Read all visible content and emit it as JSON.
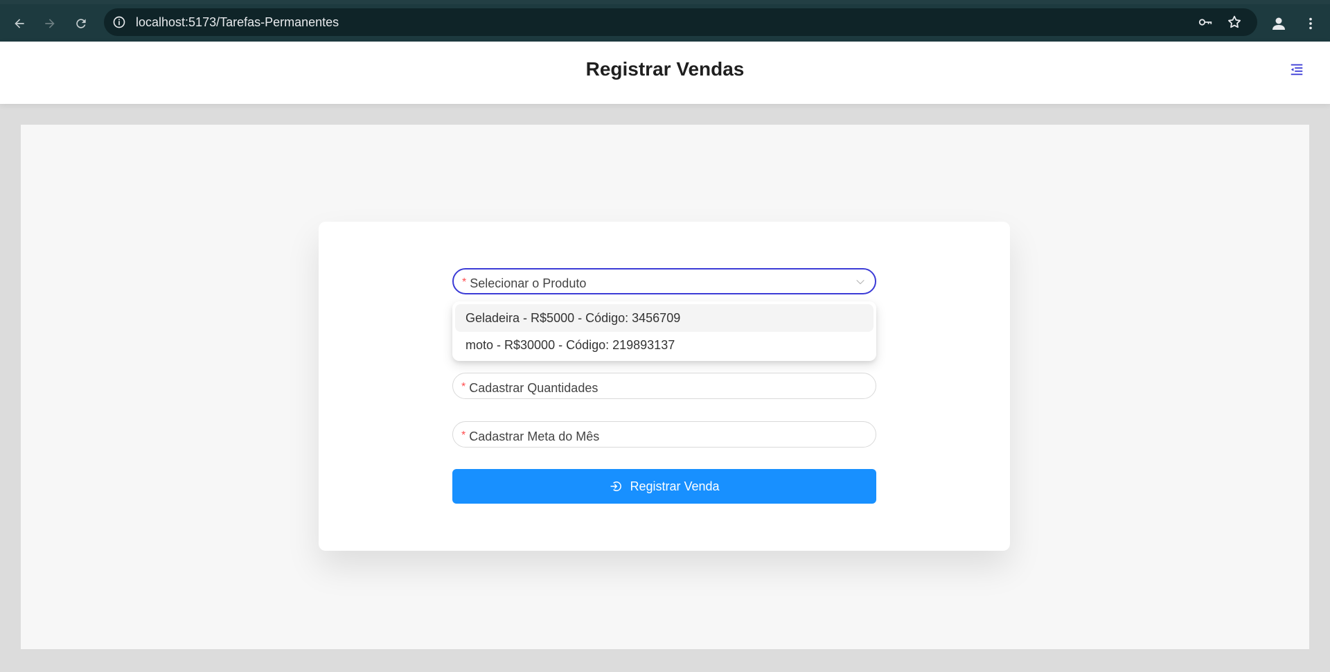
{
  "browser": {
    "url": "localhost:5173/Tarefas-Permanentes",
    "icons": [
      "back-icon",
      "forward-icon",
      "reload-icon",
      "info-icon",
      "key-icon",
      "star-icon",
      "profile-icon",
      "kebab-menu-icon"
    ]
  },
  "header": {
    "title": "Registrar Vendas",
    "menu_icon": "menu-fold-icon",
    "accent_color": "#3b3bd6"
  },
  "form": {
    "product_select": {
      "placeholder": "Selecionar o Produto",
      "required_mark": "*",
      "options": [
        "Geladeira - R$5000 - Código: 3456709",
        "moto - R$30000 - Código: 219893137"
      ]
    },
    "quantity_field": {
      "placeholder": "Cadastrar Quantidades",
      "required_mark": "*"
    },
    "goal_field": {
      "placeholder": "Cadastrar Meta do Mês",
      "required_mark": "*"
    },
    "submit": {
      "label": "Registrar Venda",
      "icon": "login-icon",
      "color": "#1890ff"
    }
  }
}
